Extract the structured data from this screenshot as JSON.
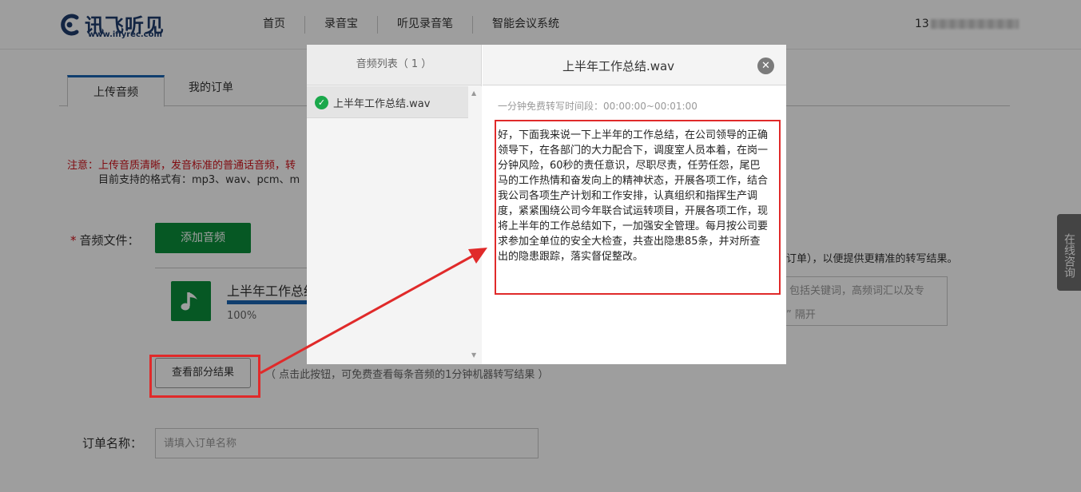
{
  "header": {
    "logo_cn": "讯飞听见",
    "logo_en": "www.iflyrec.com",
    "nav": [
      "首页",
      "录音宝",
      "听见录音笔",
      "智能会议系统"
    ],
    "user_phone_prefix": "13"
  },
  "tabs": {
    "upload": "上传音频",
    "orders": "我的订单"
  },
  "notice": {
    "warning": "注意：上传音质清晰，发音标准的普通话音频，转",
    "formats": "目前支持的格式有：mp3、wav、pcm、m"
  },
  "upload": {
    "audio_label": "音频文件：",
    "required_mark": "*",
    "add_button": "添加音频",
    "file_name": "上半年工作总结",
    "progress_text": "100%",
    "progress": 1.0,
    "right_desc": "订单），以便提供更精准的转写结果。",
    "keyword_hint_1": "包括关键词，高频词汇以及专",
    "keyword_hint_2": "” 隔开"
  },
  "partial": {
    "button": "查看部分结果",
    "hint": "（ 点击此按钮，可免费查看每条音频的1分钟机器转写结果 ）"
  },
  "order": {
    "label": "订单名称：",
    "placeholder": "请填入订单名称"
  },
  "consult": "在线咨询",
  "modal": {
    "list_header": "音频列表（ 1 ）",
    "list_items": [
      "上半年工作总结.wav"
    ],
    "title": "上半年工作总结.wav",
    "close_symbol": "✕",
    "free_time": "一分钟免费转写时间段：00:00:00~00:01:00",
    "transcript": "好，下面我来说一下上半年的工作总结，在公司领导的正确领导下，在各部门的大力配合下，调度室人员本着，在岗一分钟风险，60秒的责任意识，尽职尽责，任劳任怨，尾巴马的工作热情和奋发向上的精神状态，开展各项工作，结合我公司各项生产计划和工作安排，认真组织和指挥生产调度，紧紧围绕公司今年联合试运转项目，开展各项工作，现将上半年的工作总结如下，一加强安全管理。每月按公司要求参加全单位的安全大检查，共查出隐患85条，并对所查出的隐患跟踪，落实督促整改。"
  },
  "colors": {
    "brand_blue": "#1b64b2",
    "primary_green": "#0a8f3b",
    "highlight_red": "#e02a2a",
    "warning_red": "#d0121b"
  }
}
